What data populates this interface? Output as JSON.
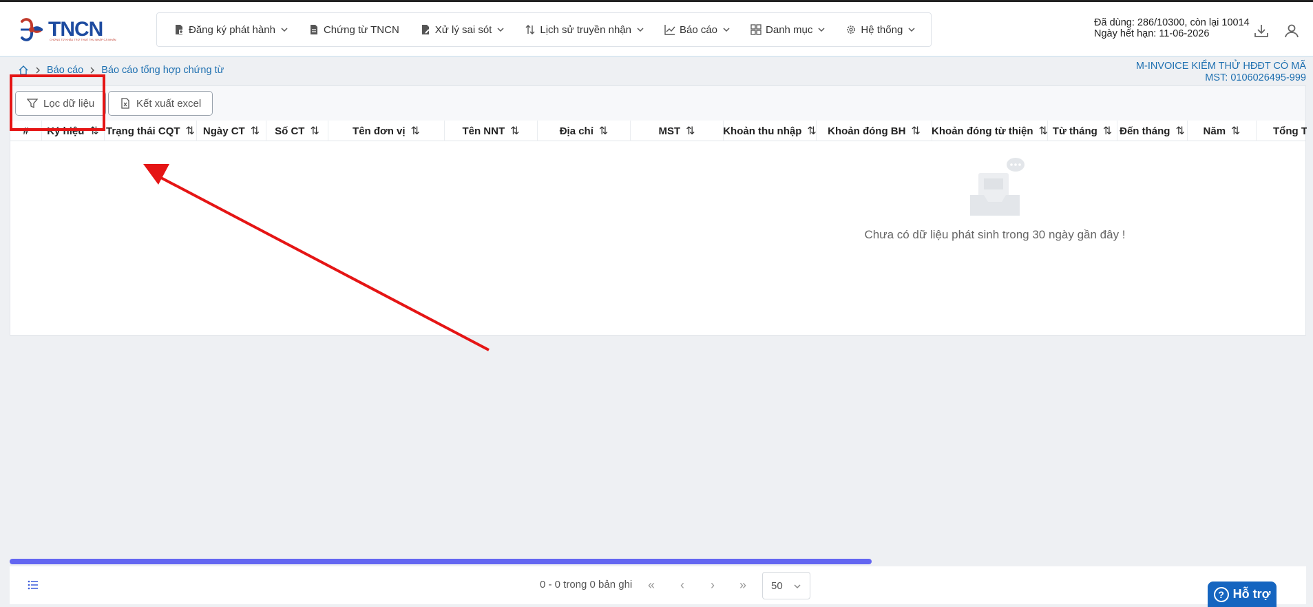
{
  "logo": {
    "text": "TNCN",
    "tagline": "CHỨNG TỪ KHẤU TRỪ THUẾ THU NHẬP CÁ NHÂN"
  },
  "menu": [
    {
      "label": "Đăng ký phát hành",
      "icon": "file-register-icon",
      "has_dropdown": true
    },
    {
      "label": "Chứng từ TNCN",
      "icon": "document-icon",
      "has_dropdown": false
    },
    {
      "label": "Xử lý sai sót",
      "icon": "file-edit-icon",
      "has_dropdown": true
    },
    {
      "label": "Lịch sử truyền nhận",
      "icon": "transfer-icon",
      "has_dropdown": true
    },
    {
      "label": "Báo cáo",
      "icon": "chart-line-icon",
      "has_dropdown": true
    },
    {
      "label": "Danh mục",
      "icon": "grid-icon",
      "has_dropdown": true
    },
    {
      "label": "Hệ thống",
      "icon": "gear-icon",
      "has_dropdown": true
    }
  ],
  "quota": {
    "line1": "Đã dùng: 286/10300, còn lại 10014",
    "line2": "Ngày hết hạn: 11-06-2026"
  },
  "breadcrumb": {
    "level1": "Báo cáo",
    "level2": "Báo cáo tổng hợp chứng từ"
  },
  "company": {
    "name": "M-INVOICE KIỂM THỬ HĐĐT CÓ MÃ",
    "tax": "MST: 0106026495-999"
  },
  "toolbar": {
    "filter_label": "Lọc dữ liệu",
    "export_label": "Kết xuất excel"
  },
  "table": {
    "columns": [
      "#",
      "Ký hiệu",
      "Trạng thái CQT",
      "Ngày CT",
      "Số CT",
      "Tên đơn vị",
      "Tên NNT",
      "Địa chỉ",
      "MST",
      "Khoản thu nhập",
      "Khoản đóng BH",
      "Khoản đóng từ thiện",
      "Từ tháng",
      "Đến tháng",
      "Năm",
      "Tổng TN c"
    ],
    "sort_glyph": "⇅",
    "empty_message": "Chưa có dữ liệu phát sinh trong 30 ngày gần đây !"
  },
  "pagination": {
    "info": "0 - 0 trong 0 bản ghi",
    "page_size": "50"
  },
  "support": {
    "label": "Hỗ trợ"
  },
  "colors": {
    "brand_blue": "#1d4ba0",
    "link_blue": "#1d6fb0",
    "annotation_red": "#e51515",
    "scrollbar": "#6366f1",
    "support_bg": "#1565c0"
  }
}
